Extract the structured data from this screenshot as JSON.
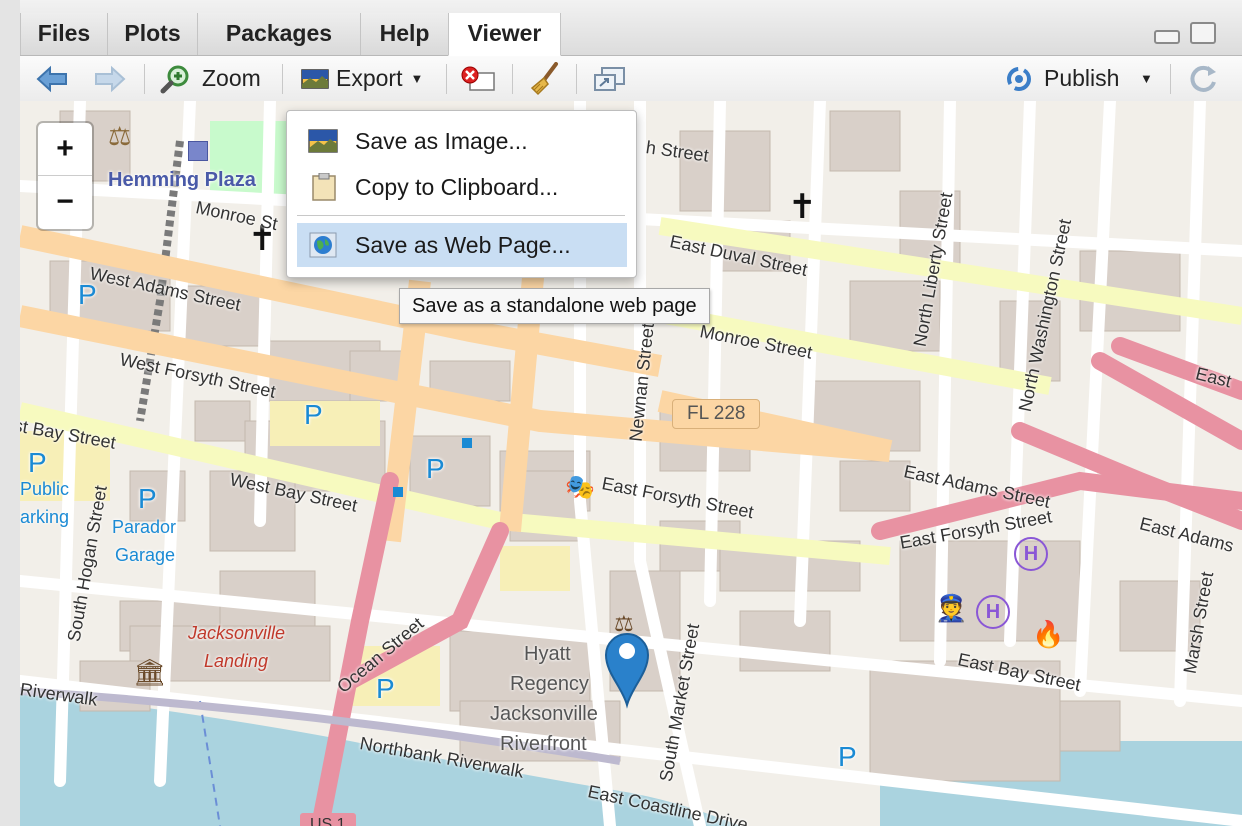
{
  "tabs": [
    {
      "label": "Files"
    },
    {
      "label": "Plots"
    },
    {
      "label": "Packages"
    },
    {
      "label": "Help"
    },
    {
      "label": "Viewer",
      "active": true
    }
  ],
  "toolbar": {
    "zoom_label": "Zoom",
    "export_label": "Export",
    "publish_label": "Publish"
  },
  "export_menu": {
    "items": [
      {
        "label": "Save as Image...",
        "icon": "image-icon"
      },
      {
        "label": "Copy to Clipboard...",
        "icon": "clipboard-icon"
      },
      {
        "label": "Save as Web Page...",
        "icon": "globe-icon",
        "highlighted": true
      }
    ],
    "tooltip": "Save as a standalone web page"
  },
  "map": {
    "zoom_in": "+",
    "zoom_out": "−",
    "labels": {
      "hemming_plaza": "Hemming Plaza",
      "monroe_st_w": "Monroe St",
      "west_adams": "West Adams Street",
      "west_forsyth": "West Forsyth Street",
      "west_bay": "West Bay Street",
      "west_bay_left": "st Bay Street",
      "east_duval": "East Duval Street",
      "monroe_e": "Monroe Street",
      "n_liberty": "North Liberty Street",
      "n_washington": "North Washington Street",
      "newnan": "Newnan Street",
      "fl228": "FL 228",
      "east_forsyth": "East Forsyth Street",
      "east_adams": "East Adams Street",
      "east_forsyth_r": "East Forsyth Street",
      "east_adams_r": "East Adams",
      "east_bay": "East Bay Street",
      "marsh": "Marsh Street",
      "south_market": "South Market Street",
      "south_hogan": "South Hogan Street",
      "ocean": "Ocean Street",
      "northbank": "Northbank Riverwalk",
      "east_coastline": "East Coastline Drive",
      "riverwalk": "Riverwalk",
      "public_parking_1": "Public",
      "public_parking_2": "arking",
      "parador_1": "Parador",
      "parador_2": "Garage",
      "jax_landing_1": "Jacksonville",
      "jax_landing_2": "Landing",
      "hyatt_1": "Hyatt",
      "hyatt_2": "Regency",
      "hyatt_3": "Jacksonville",
      "hyatt_4": "Riverfront",
      "us1": "US 1",
      "east_top": "East",
      "h_street": "h Street",
      "parking": "P"
    },
    "colors": {
      "land": "#f2efe9",
      "building": "#d9d0c9",
      "primary_road": "#fcd6a4",
      "secondary_road": "#f7fabf",
      "trunk_road": "#e892a2",
      "water": "#aad3df",
      "park": "#c8facc",
      "parking_lot": "#eeeeee",
      "marker": "#2a81cb"
    }
  }
}
